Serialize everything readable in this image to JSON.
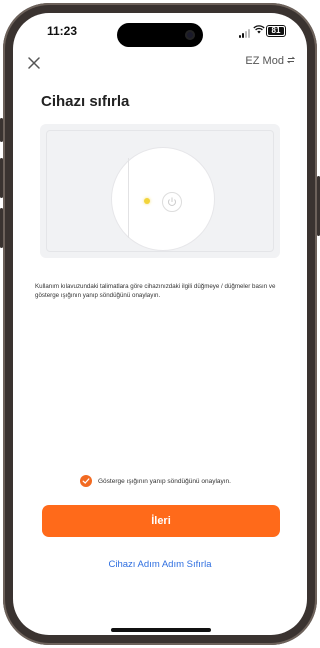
{
  "status_bar": {
    "time": "11:23",
    "battery": "81"
  },
  "header": {
    "close_icon": "close-icon",
    "ez_mode_label": "EZ Mod",
    "switch_icon": "swap-arrows-icon"
  },
  "page": {
    "title": "Cihazı sıfırla",
    "description": "Kullanım kılavuzundaki talimatlara göre cihazınızdaki ilgili düğmeye / düğmeler basın ve gösterge ışığının yanıp söndüğünü onaylayın.",
    "illustration": {
      "device_icon": "power-button-icon",
      "led_color": "#f2d43a"
    }
  },
  "confirm": {
    "checked": true,
    "label": "Gösterge ışığının yanıp söndüğünü onaylayın."
  },
  "buttons": {
    "next_label": "İleri",
    "step_reset_link": "Cihazı Adım Adım Sıfırla"
  },
  "colors": {
    "accent": "#ff6a1a",
    "link": "#2f6fe0"
  }
}
